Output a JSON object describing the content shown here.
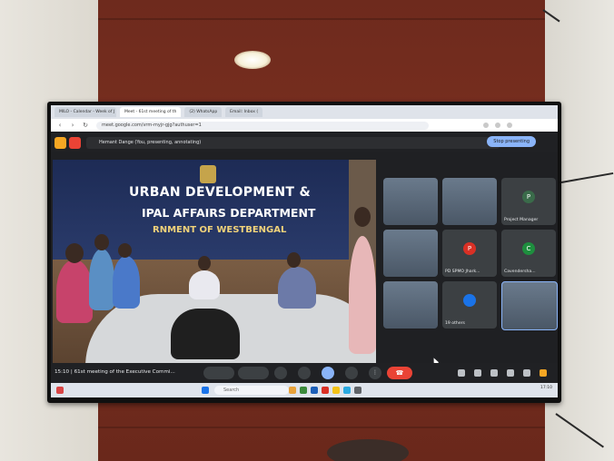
{
  "browser": {
    "tabs": [
      "MILO - Calendar - Week of J",
      "Meet - 61st meeting of th",
      "(2) WhatsApp",
      "Email: Inbox ("
    ],
    "url": "meet.google.com/vrm-myjr-gjg?authuser=1"
  },
  "presenting_bar": {
    "text": "Hemant Dange (You, presenting, annotating)",
    "stop_button": "Stop presenting"
  },
  "presented_video": {
    "banner_line1": "URBAN DEVELOPMENT &",
    "banner_line2": "IPAL AFFAIRS DEPARTMENT",
    "banner_line3": "RNMENT OF WESTBENGAL"
  },
  "participants": [
    {
      "label": "",
      "type": "video"
    },
    {
      "label": "",
      "type": "video"
    },
    {
      "label": "Project Manager",
      "avatar": "P",
      "color": "#3a6b4a"
    },
    {
      "label": "",
      "type": "video"
    },
    {
      "label": "PD SPMO Jhark...",
      "avatar": "P",
      "color": "#d93025"
    },
    {
      "label": "Cavendersha...",
      "avatar": "C",
      "color": "#1e8e3e"
    },
    {
      "label": "",
      "type": "video"
    },
    {
      "label": "19 others",
      "avatar": "",
      "color": "#1a73e8"
    },
    {
      "label": "",
      "type": "video"
    }
  ],
  "control_bar": {
    "time": "15:10",
    "meeting_title": "61st meeting of the Executive Commi..."
  },
  "taskbar": {
    "search": "Search",
    "clock": "17:10"
  },
  "colors": {
    "meet_bg": "#202124",
    "end_call": "#ea4335",
    "present_btn": "#8ab4f8",
    "panel_wood": "#7b3020"
  }
}
